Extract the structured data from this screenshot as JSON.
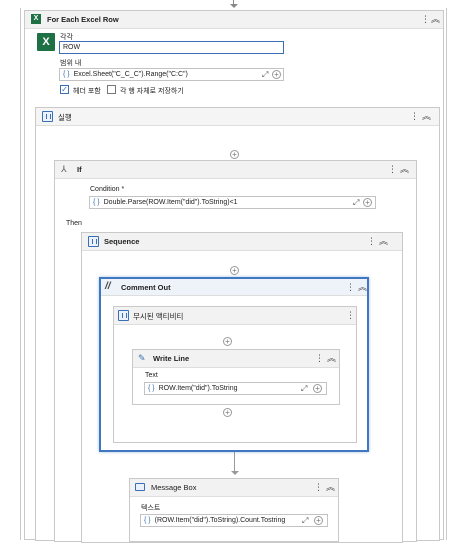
{
  "foreach": {
    "title": "For Each Excel Row",
    "item_label": "각각",
    "item_value": "ROW",
    "range_label": "범위 내",
    "range_value": "Excel.Sheet(\"C_C_C\").Range(\"C:C\")",
    "check1_label": "헤더 포함",
    "check2_label": "각 행 자체로 저장하기",
    "check1_checked": true,
    "check2_checked": false
  },
  "body": {
    "title": "실행"
  },
  "if_block": {
    "title": "If",
    "condition_label": "Condition *",
    "condition_value": "Double.Parse(ROW.Item(\"did\").ToString)<1",
    "then_label": "Then"
  },
  "sequence": {
    "title": "Sequence"
  },
  "comment_out": {
    "title": "Comment Out"
  },
  "ignored": {
    "title": "무시된 액티비티"
  },
  "write_line": {
    "title": "Write Line",
    "text_label": "Text",
    "text_value": "ROW.Item(\"did\").ToString"
  },
  "message_box": {
    "title": "Message Box",
    "text_label": "텍스트",
    "text_value": "(ROW.Item(\"did\").ToString).Count.Tostring"
  },
  "icons": {
    "menu": "⋮",
    "collapse": "︽",
    "expand_field": "⤢",
    "add": "+",
    "brace": "{ }"
  }
}
